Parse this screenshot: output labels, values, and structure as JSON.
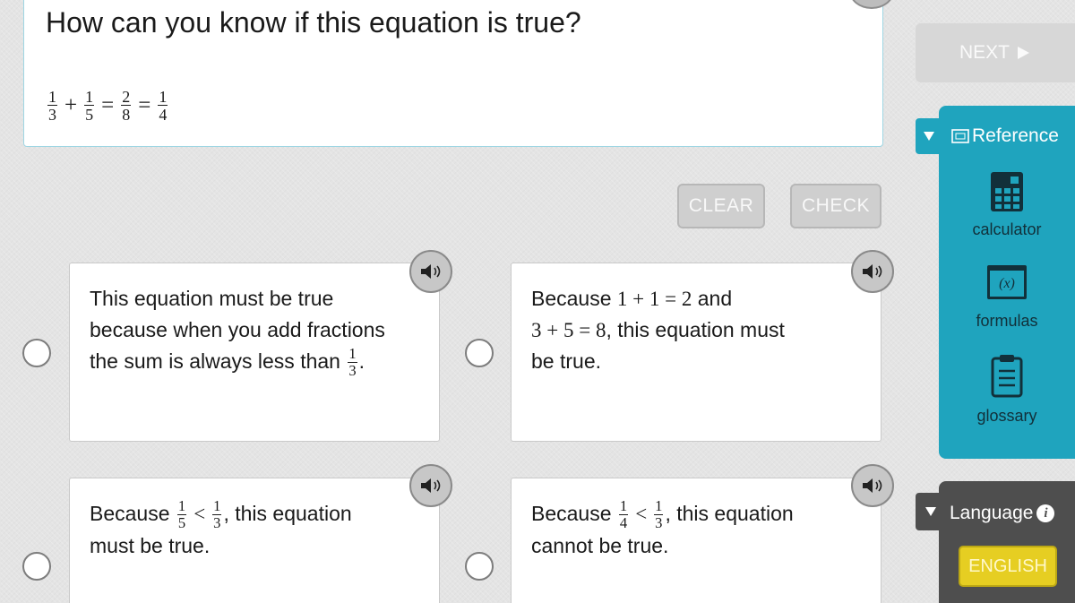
{
  "question": {
    "title": "How can you know if this equation is true?",
    "equation": {
      "f1": {
        "num": "1",
        "den": "3"
      },
      "op1": "+",
      "f2": {
        "num": "1",
        "den": "5"
      },
      "op2": "=",
      "f3": {
        "num": "2",
        "den": "8"
      },
      "op3": "=",
      "f4": {
        "num": "1",
        "den": "4"
      }
    }
  },
  "actions": {
    "clear_label": "CLEAR",
    "check_label": "CHECK"
  },
  "options": [
    {
      "line1": "This equation must be true",
      "line2": "because when you add fractions",
      "line3": "the sum is always less than",
      "frac": {
        "num": "1",
        "den": "3"
      },
      "end": "."
    },
    {
      "pre": "Because",
      "math1": "1 + 1 = 2",
      "mid": "and",
      "math2": "3 + 5 = 8",
      "post": ", this equation must",
      "line3": "be true."
    },
    {
      "pre": "Because",
      "fa": {
        "num": "1",
        "den": "5"
      },
      "op": "<",
      "fb": {
        "num": "1",
        "den": "3"
      },
      "post": ", this equation",
      "line2": "must be true."
    },
    {
      "pre": "Because",
      "fa": {
        "num": "1",
        "den": "4"
      },
      "op": "<",
      "fb": {
        "num": "1",
        "den": "3"
      },
      "post": ", this equation",
      "line2": "cannot be true."
    }
  ],
  "sidebar": {
    "next_label": "NEXT",
    "reference": {
      "header": "Reference",
      "tools": [
        {
          "label": "calculator",
          "icon": "calculator-icon"
        },
        {
          "label": "formulas",
          "icon": "formulas-icon",
          "icon_text": "(x)"
        },
        {
          "label": "glossary",
          "icon": "glossary-icon"
        }
      ]
    },
    "language": {
      "header": "Language",
      "info_glyph": "i",
      "english_label": "ENGLISH"
    }
  },
  "colors": {
    "reference_panel": "#1fa4be",
    "language_panel": "#4e4e4e",
    "english_button": "#e6ce22"
  }
}
